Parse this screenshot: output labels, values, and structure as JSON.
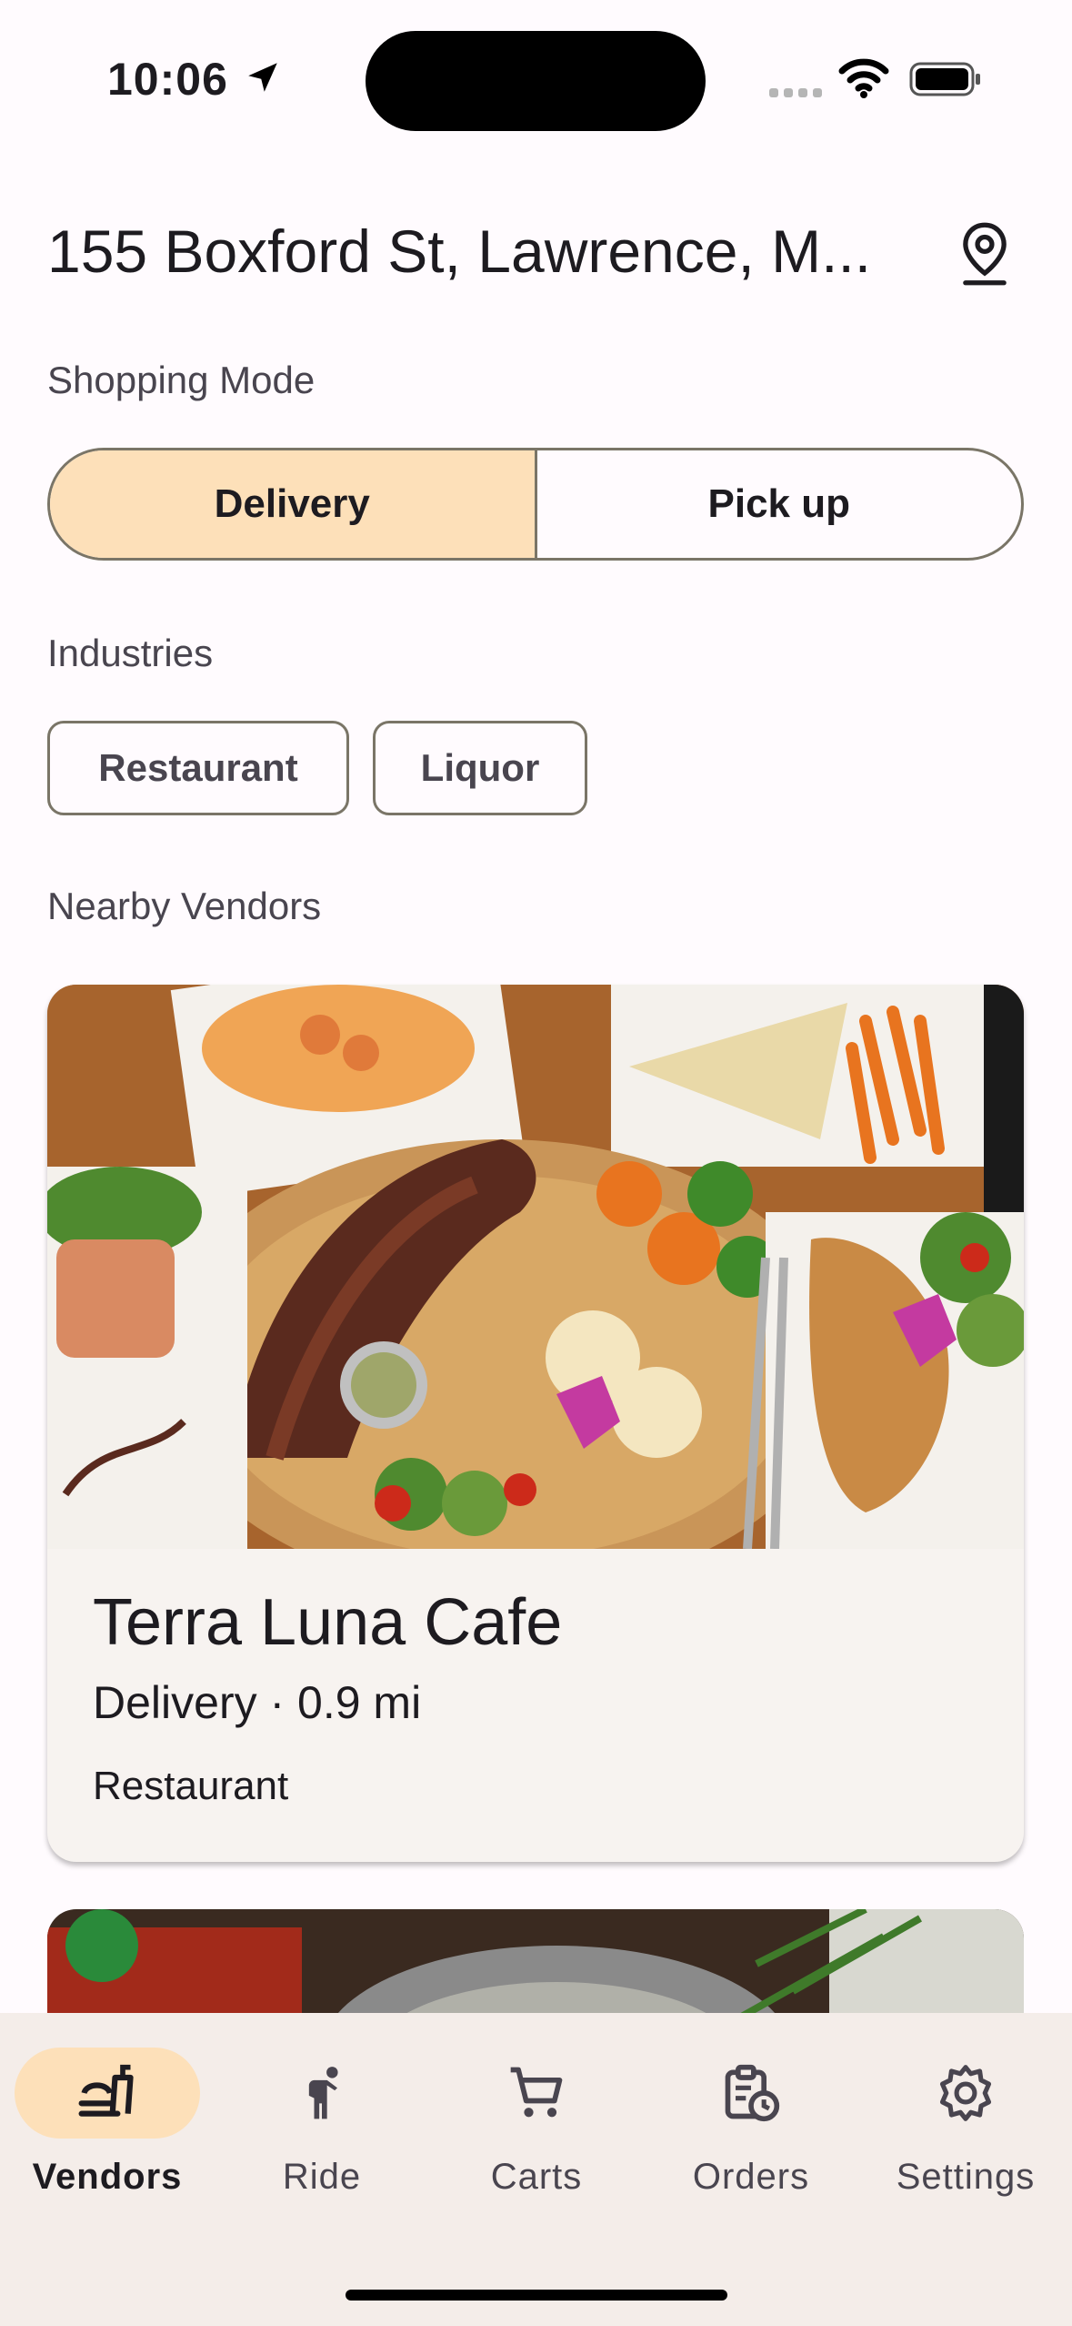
{
  "status": {
    "time": "10:06"
  },
  "header": {
    "address": "155 Boxford St, Lawrence, M...",
    "location_icon": "location-pin-icon"
  },
  "shopping_mode": {
    "label": "Shopping Mode",
    "options": [
      "Delivery",
      "Pick up"
    ],
    "selected": "Delivery"
  },
  "industries": {
    "label": "Industries",
    "chips": [
      "Restaurant",
      "Liquor"
    ]
  },
  "nearby": {
    "label": "Nearby Vendors",
    "vendors": [
      {
        "name": "Terra Luna Cafe",
        "meta": "Delivery · 0.9 mi",
        "industry": "Restaurant"
      }
    ]
  },
  "nav": {
    "items": [
      {
        "label": "Vendors",
        "icon": "vendors-icon",
        "active": true
      },
      {
        "label": "Ride",
        "icon": "ride-icon",
        "active": false
      },
      {
        "label": "Carts",
        "icon": "cart-icon",
        "active": false
      },
      {
        "label": "Orders",
        "icon": "orders-icon",
        "active": false
      },
      {
        "label": "Settings",
        "icon": "gear-icon",
        "active": false
      }
    ]
  },
  "colors": {
    "accent": "#fde0b9",
    "outline": "#7a7567",
    "card": "#f7f3f0",
    "nav": "#f4ede9"
  }
}
